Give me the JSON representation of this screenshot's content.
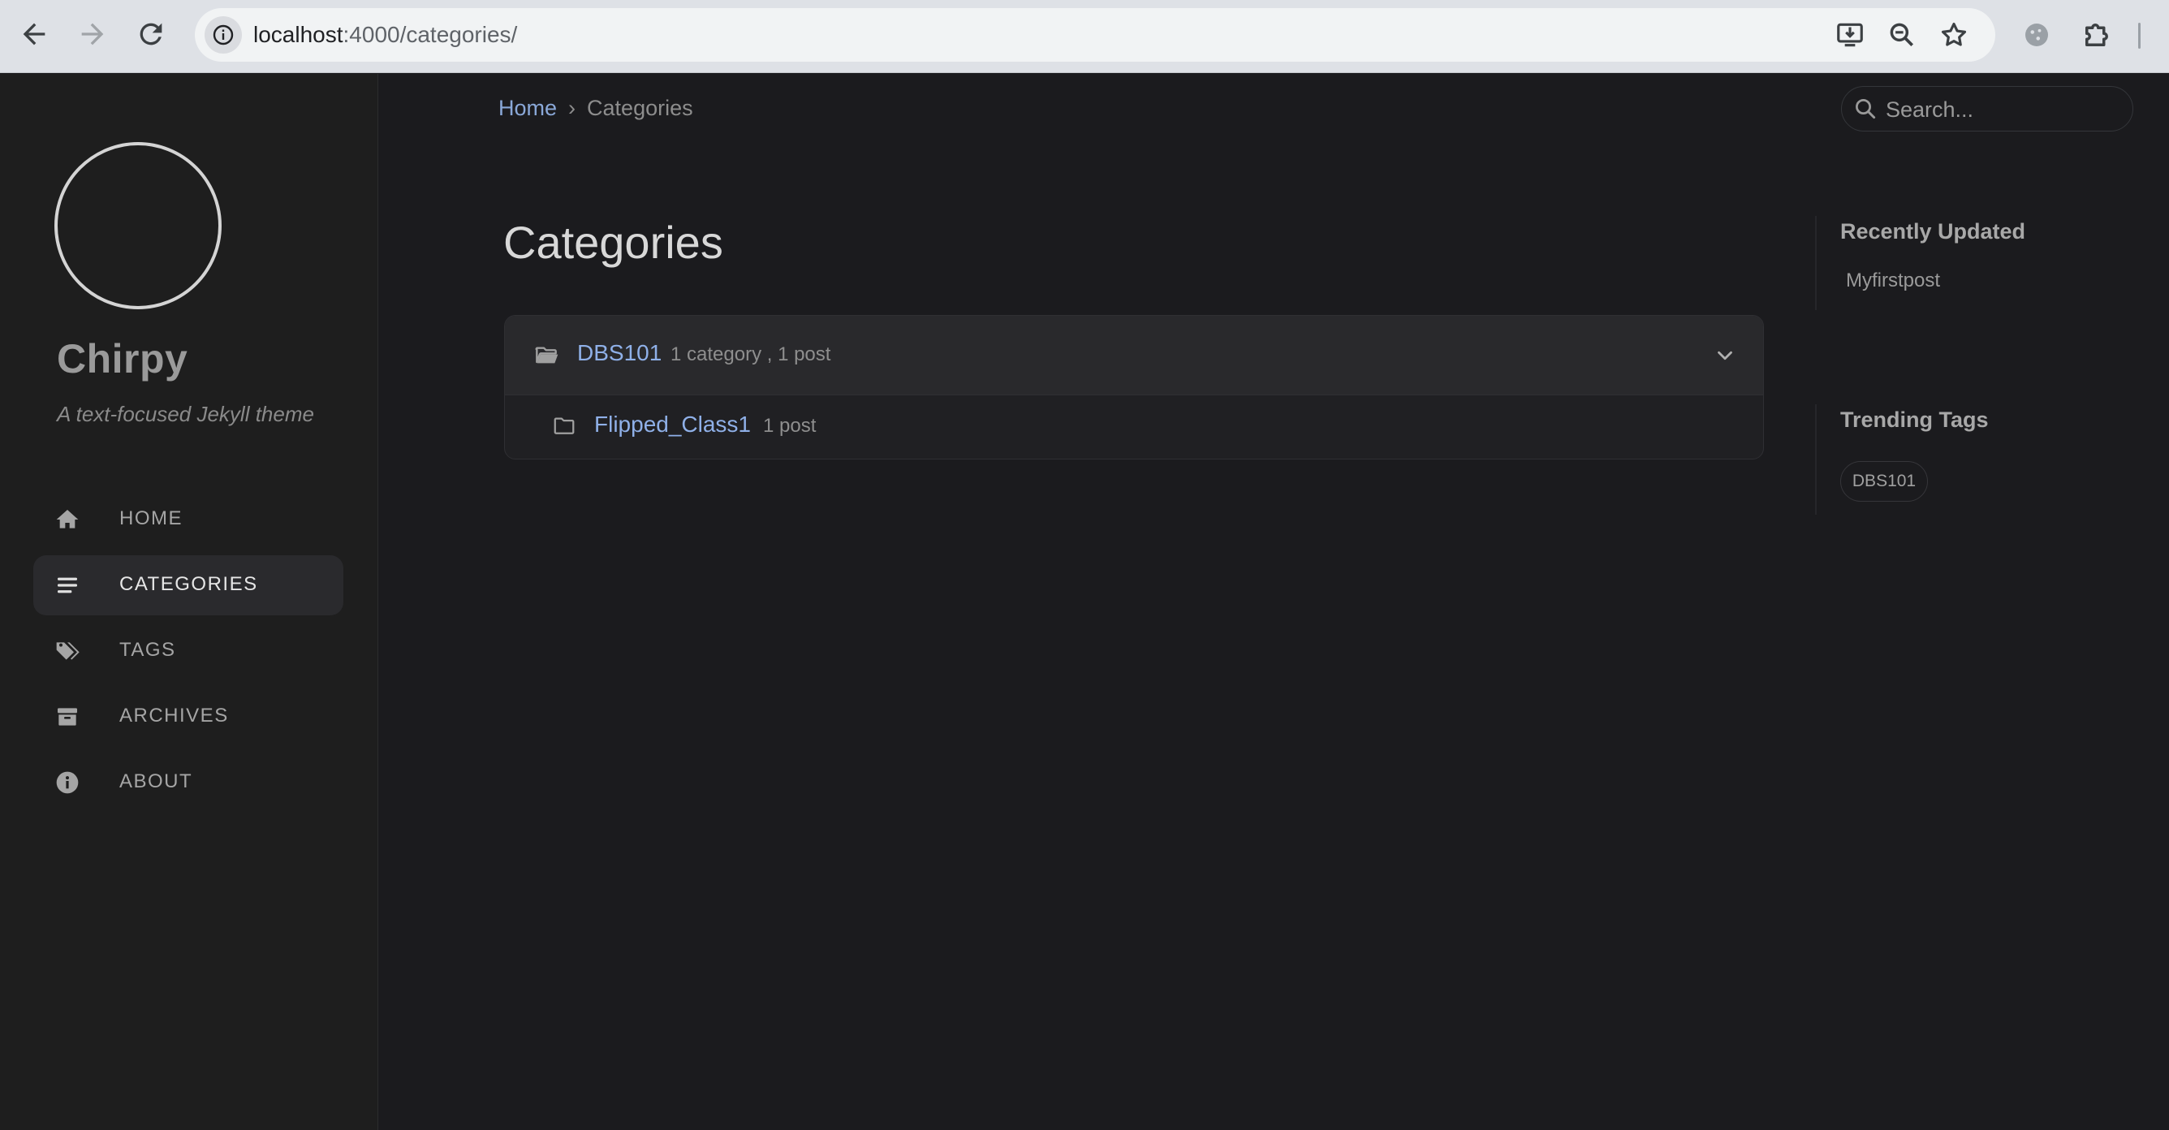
{
  "browser": {
    "url_host": "localhost",
    "url_path": ":4000/categories/"
  },
  "sidebar": {
    "site_title": "Chirpy",
    "site_subtitle": "A text-focused Jekyll theme",
    "items": [
      {
        "label": "HOME",
        "icon": "home-icon"
      },
      {
        "label": "CATEGORIES",
        "icon": "list-icon",
        "active": true
      },
      {
        "label": "TAGS",
        "icon": "tags-icon"
      },
      {
        "label": "ARCHIVES",
        "icon": "archive-icon"
      },
      {
        "label": "ABOUT",
        "icon": "info-icon"
      }
    ]
  },
  "breadcrumb": {
    "home": "Home",
    "separator": "›",
    "current": "Categories"
  },
  "search": {
    "placeholder": "Search..."
  },
  "main": {
    "title": "Categories",
    "category": {
      "name": "DBS101",
      "meta": "1 category , 1 post",
      "subcategory": {
        "name": "Flipped_Class1",
        "meta": "1 post"
      }
    }
  },
  "panel": {
    "recently_updated_heading": "Recently Updated",
    "recently_updated_items": [
      "Myfirstpost"
    ],
    "trending_tags_heading": "Trending Tags",
    "trending_tags": [
      "DBS101"
    ]
  },
  "colors": {
    "background": "#1b1b1e",
    "sidebar": "#1e1e1e",
    "link": "#8fb0e8",
    "active_nav": "#2a2a2d"
  }
}
